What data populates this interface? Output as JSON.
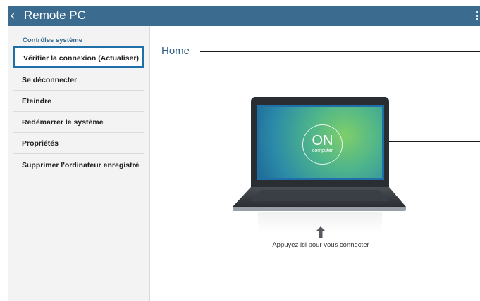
{
  "appbar": {
    "back_icon": "chevron-left-icon",
    "title": "Remote PC",
    "menu_icon": "overflow-menu-icon",
    "color": "#3b6b8e"
  },
  "sidebar": {
    "section_title": "Contrôles système",
    "items": [
      {
        "label": "Vérifier la connexion (Actualiser)",
        "selected": true
      },
      {
        "label": "Se déconnecter"
      },
      {
        "label": "Eteindre"
      },
      {
        "label": "Redémarrer le système"
      },
      {
        "label": "Propriétés"
      },
      {
        "label": "Supprimer l'ordinateur enregistré"
      }
    ]
  },
  "main": {
    "home_label": "Home",
    "screen": {
      "status": "ON",
      "caption": "computer"
    },
    "connect_hint": "Appuyez ici pour vous connecter",
    "arrow_icon": "arrow-up-icon"
  },
  "colors": {
    "highlight": "#1f6fa8",
    "sidebar_bg": "#f3f3f3"
  }
}
